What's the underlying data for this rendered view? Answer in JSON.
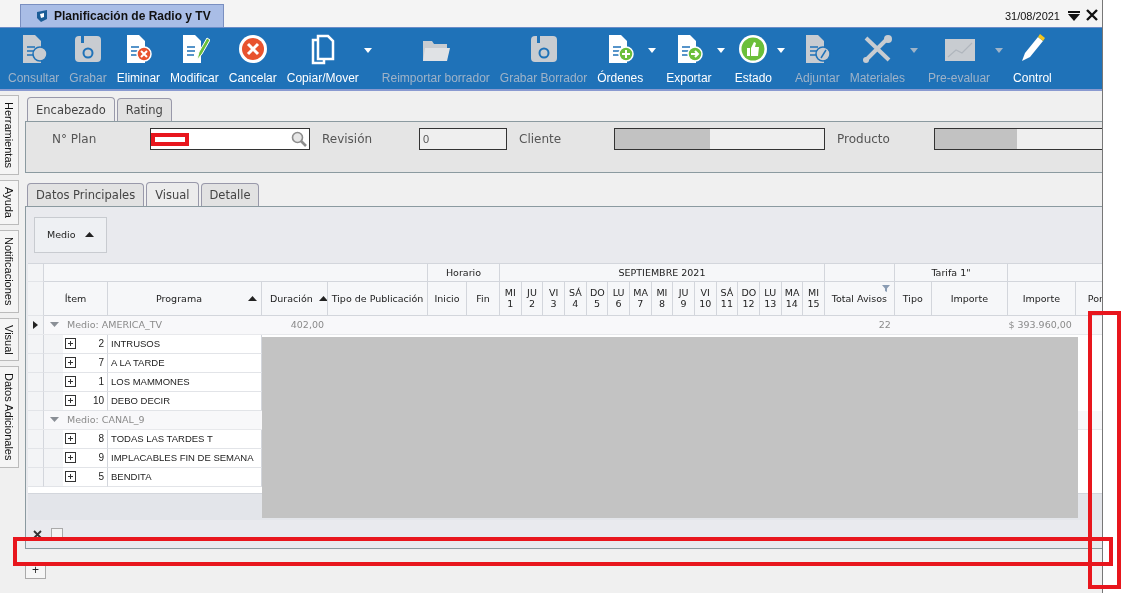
{
  "window": {
    "title": "Planificación de Radio y TV",
    "date": "31/08/2021"
  },
  "toolbar": [
    {
      "label": "Consultar",
      "disabled": true,
      "dropdown": false
    },
    {
      "label": "Grabar",
      "disabled": true,
      "dropdown": false
    },
    {
      "label": "Eliminar",
      "disabled": false,
      "dropdown": false
    },
    {
      "label": "Modificar",
      "disabled": false,
      "dropdown": false
    },
    {
      "label": "Cancelar",
      "disabled": false,
      "dropdown": false
    },
    {
      "label": "Copiar/Mover",
      "disabled": false,
      "dropdown": true
    },
    {
      "label": "Reimportar borrador",
      "disabled": true,
      "dropdown": false
    },
    {
      "label": "Grabar Borrador",
      "disabled": true,
      "dropdown": false
    },
    {
      "label": "Órdenes",
      "disabled": false,
      "dropdown": true
    },
    {
      "label": "Exportar",
      "disabled": false,
      "dropdown": true
    },
    {
      "label": "Estado",
      "disabled": false,
      "dropdown": true
    },
    {
      "label": "Adjuntar",
      "disabled": true,
      "dropdown": false
    },
    {
      "label": "Materiales",
      "disabled": true,
      "dropdown": true
    },
    {
      "label": "Pre-evaluar",
      "disabled": true,
      "dropdown": true
    },
    {
      "label": "Control",
      "disabled": false,
      "dropdown": false
    }
  ],
  "side_tabs": [
    {
      "label": "Herramientas"
    },
    {
      "label": "Ayuda"
    },
    {
      "label": "Notificaciones"
    },
    {
      "label": "Visual"
    },
    {
      "label": "Datos Adicionales"
    }
  ],
  "header_tabs": [
    {
      "label": "Encabezado",
      "selected": true
    },
    {
      "label": "Rating",
      "selected": false
    }
  ],
  "header_fields": [
    {
      "label": "N° Plan",
      "search": true,
      "marked": true,
      "redacted": false
    },
    {
      "label": "Revisión",
      "value": "0",
      "search": false,
      "marked": false,
      "redacted": false
    },
    {
      "label": "Cliente",
      "search": false,
      "marked": false,
      "redacted": true
    },
    {
      "label": "Producto",
      "search": false,
      "marked": false,
      "redacted": true
    }
  ],
  "detail_tabs": [
    {
      "label": "Datos Principales",
      "selected": false
    },
    {
      "label": "Visual",
      "selected": true
    },
    {
      "label": "Detalle",
      "selected": false
    }
  ],
  "group_by": [
    {
      "label": "Medio",
      "sort_ascending": true
    }
  ],
  "grid": {
    "column_groups": [
      {
        "columns": [
          {
            "label": "Ítem"
          },
          {
            "label": "Programa",
            "sort_ascending": true
          },
          {
            "label": "Duración",
            "sort_ascending": true
          },
          {
            "label": "Tipo de Publicación"
          }
        ]
      },
      {
        "label": "Horario",
        "columns": [
          {
            "label": "Inicio"
          },
          {
            "label": "Fin"
          }
        ]
      },
      {
        "label": "SEPTIEMBRE 2021",
        "columns": [
          {
            "label": "MI 1"
          },
          {
            "label": "JU 2"
          },
          {
            "label": "VI 3"
          },
          {
            "label": "SÁ 4"
          },
          {
            "label": "DO 5"
          },
          {
            "label": "LU 6"
          },
          {
            "label": "MA 7"
          },
          {
            "label": "MI 8"
          },
          {
            "label": "JU 9"
          },
          {
            "label": "VI 10"
          },
          {
            "label": "SÁ 11"
          },
          {
            "label": "DO 12"
          },
          {
            "label": "LU 13"
          },
          {
            "label": "MA 14"
          },
          {
            "label": "MI 15"
          }
        ]
      },
      {
        "columns": [
          {
            "label": "Total Avisos",
            "filter": true
          }
        ]
      },
      {
        "label": "Tarifa 1\"",
        "columns": [
          {
            "label": "Tipo"
          },
          {
            "label": "Importe"
          }
        ]
      },
      {
        "columns": [
          {
            "label": "Importe"
          }
        ]
      },
      {
        "columns": [
          {
            "label": "Por"
          }
        ]
      }
    ],
    "groups": [
      {
        "label": "Medio: AMERICA_TV",
        "expanded": true,
        "current": true,
        "duracion": "402,00",
        "total_avisos": "22",
        "importe": "$ 393.960,00",
        "rows": [
          {
            "item": "2",
            "programa": "INTRUSOS",
            "expanded": false
          },
          {
            "item": "7",
            "programa": "A LA TARDE",
            "expanded": false
          },
          {
            "item": "1",
            "programa": "LOS MAMMONES",
            "expanded": false
          },
          {
            "item": "10",
            "programa": "DEBO DECIR",
            "expanded": false
          }
        ]
      },
      {
        "label": "Medio: CANAL_9",
        "expanded": true,
        "current": false,
        "rows": [
          {
            "item": "8",
            "programa": "TODAS LAS TARDES T",
            "expanded": false
          },
          {
            "item": "9",
            "programa": "IMPLACABLES FIN DE SEMANA",
            "expanded": false
          },
          {
            "item": "5",
            "programa": "BENDITA",
            "expanded": false
          }
        ]
      }
    ]
  },
  "filter_bar": {
    "enabled": false
  },
  "bottom_tabs": [
    {
      "label": "+"
    }
  ]
}
